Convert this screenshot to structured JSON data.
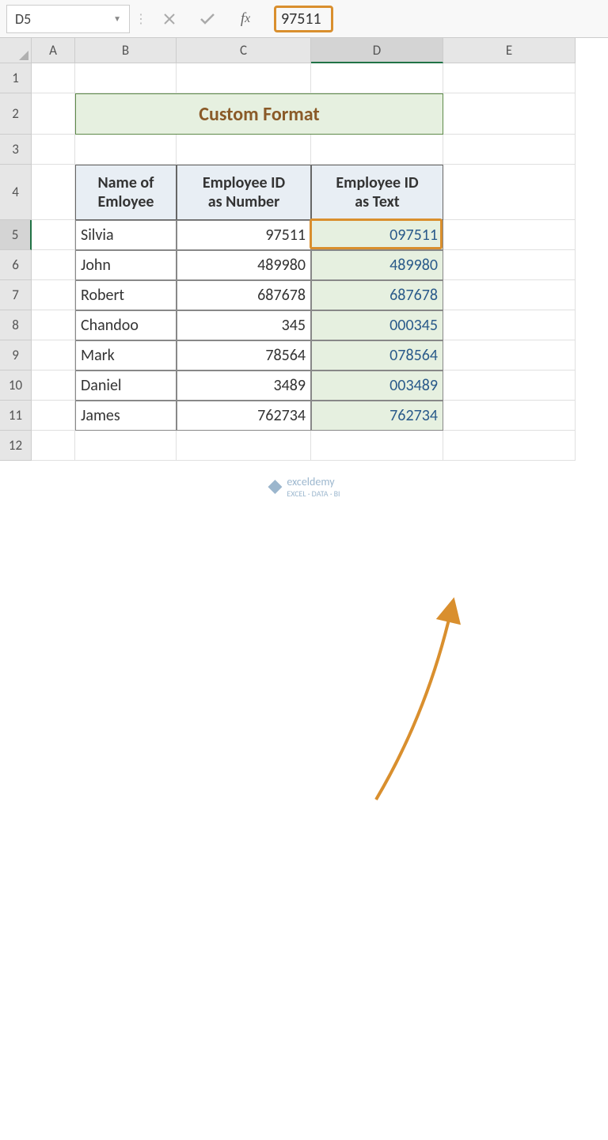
{
  "formula_bar": {
    "name_box": "D5",
    "formula_value": "97511"
  },
  "columns": [
    {
      "label": "A",
      "width": 55
    },
    {
      "label": "B",
      "width": 128
    },
    {
      "label": "C",
      "width": 170
    },
    {
      "label": "D",
      "width": 167
    },
    {
      "label": "E",
      "width": 167
    }
  ],
  "row_heights": {
    "default": 38,
    "2": 52,
    "4": 70
  },
  "title": "Custom Format",
  "headers": {
    "b": "Name of Emloyee",
    "c": "Employee ID as Number",
    "d": "Employee ID as Text"
  },
  "rows": [
    {
      "name": "Silvia",
      "num": "97511",
      "text": "097511"
    },
    {
      "name": "John",
      "num": "489980",
      "text": "489980"
    },
    {
      "name": "Robert",
      "num": "687678",
      "text": "687678"
    },
    {
      "name": "Chandoo",
      "num": "345",
      "text": "000345"
    },
    {
      "name": "Mark",
      "num": "78564",
      "text": "078564"
    },
    {
      "name": "Daniel",
      "num": "3489",
      "text": "003489"
    },
    {
      "name": "James",
      "num": "762734",
      "text": "762734"
    }
  ],
  "selected_cell": "D5",
  "watermark": {
    "brand": "exceldemy",
    "tagline": "EXCEL · DATA · BI"
  }
}
